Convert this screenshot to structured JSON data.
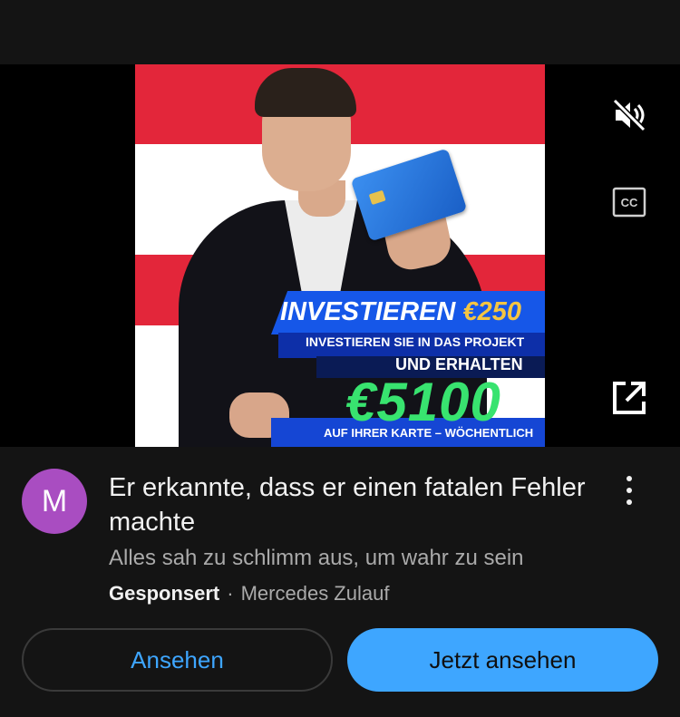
{
  "video": {
    "thumbnail": {
      "headline": "INVESTIEREN",
      "headline_amount": "€250",
      "line1": "INVESTIEREN SIE IN DAS PROJEKT",
      "line2": "UND ERHALTEN",
      "big_amount": "€5100",
      "line3": "AUF IHRER KARTE – WÖCHENTLICH",
      "colors": {
        "flag_red": "#e3263a",
        "banner_blue": "#1657e8",
        "amount_green": "#38e36f",
        "amount_gold": "#f5c542"
      }
    },
    "controls": {
      "mute_icon": "speaker-muted-icon",
      "cc_icon": "closed-captions-icon",
      "cc_label": "CC",
      "external_icon": "open-external-icon"
    }
  },
  "ad": {
    "avatar_letter": "M",
    "avatar_color": "#a94dc1",
    "title": "Er erkannte, dass er einen fatalen Fehler machte",
    "description": "Alles sah zu schlimm aus, um wahr zu sein",
    "sponsored_label": "Gesponsert",
    "separator": "·",
    "advertiser": "Mercedes Zulauf",
    "menu_icon": "more-vertical-icon"
  },
  "actions": {
    "secondary_label": "Ansehen",
    "primary_label": "Jetzt ansehen",
    "accent": "#3ea6ff"
  }
}
